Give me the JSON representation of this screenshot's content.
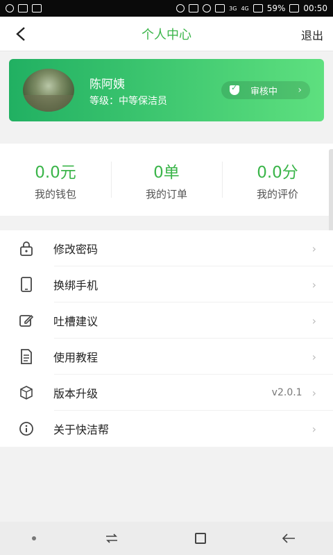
{
  "status": {
    "battery": "59%",
    "time": "00:50",
    "net3g": "3G",
    "net4g": "4G"
  },
  "header": {
    "title": "个人中心",
    "logout": "退出"
  },
  "profile": {
    "name": "陈阿姨",
    "level": "等级：中等保洁员",
    "review_status": "审核中"
  },
  "stats": [
    {
      "value": "0.0元",
      "label": "我的钱包"
    },
    {
      "value": "0单",
      "label": "我的订单"
    },
    {
      "value": "0.0分",
      "label": "我的评价"
    }
  ],
  "menu": [
    {
      "label": "修改密码",
      "icon": "lock-icon"
    },
    {
      "label": "换绑手机",
      "icon": "phone-icon"
    },
    {
      "label": "吐槽建议",
      "icon": "edit-icon"
    },
    {
      "label": "使用教程",
      "icon": "document-icon"
    },
    {
      "label": "版本升级",
      "icon": "package-icon",
      "value": "v2.0.1"
    },
    {
      "label": "关于快洁帮",
      "icon": "info-icon"
    }
  ],
  "colors": {
    "accent": "#3bb54a",
    "card_start": "#21b062",
    "card_end": "#5ee07f"
  }
}
